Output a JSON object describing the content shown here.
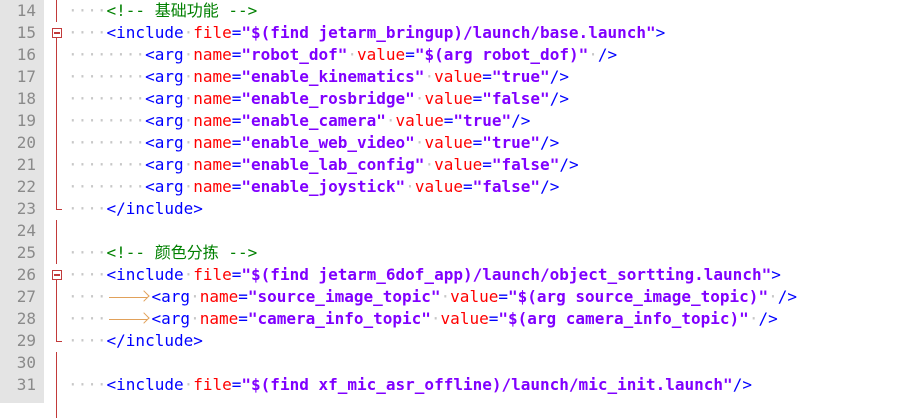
{
  "line_numbers": [
    "14",
    "15",
    "16",
    "17",
    "18",
    "19",
    "20",
    "21",
    "22",
    "23",
    "24",
    "25",
    "26",
    "27",
    "28",
    "29",
    "30",
    "31"
  ],
  "lines": {
    "l14": {
      "c1": "<!-- ",
      "c2": "基础功能",
      "c3": " -->"
    },
    "l15": {
      "tag": "<include",
      "a1": "file",
      "eq": "=",
      "v1": "\"$(find jetarm_bringup)/launch/base.launch\"",
      "close": ">"
    },
    "l16": {
      "tag": "<arg",
      "a1": "name",
      "eq1": "=",
      "v1": "\"robot_dof\"",
      "a2": "value",
      "eq2": "=",
      "v2": "\"$(arg robot_dof)\"",
      "close": "/>"
    },
    "l17": {
      "tag": "<arg",
      "a1": "name",
      "eq1": "=",
      "v1": "\"enable_kinematics\"",
      "a2": "value",
      "eq2": "=",
      "v2": "\"true\"",
      "close": "/>"
    },
    "l18": {
      "tag": "<arg",
      "a1": "name",
      "eq1": "=",
      "v1": "\"enable_rosbridge\"",
      "a2": "value",
      "eq2": "=",
      "v2": "\"false\"",
      "close": "/>"
    },
    "l19": {
      "tag": "<arg",
      "a1": "name",
      "eq1": "=",
      "v1": "\"enable_camera\"",
      "a2": "value",
      "eq2": "=",
      "v2": "\"true\"",
      "close": "/>"
    },
    "l20": {
      "tag": "<arg",
      "a1": "name",
      "eq1": "=",
      "v1": "\"enable_web_video\"",
      "a2": "value",
      "eq2": "=",
      "v2": "\"true\"",
      "close": "/>"
    },
    "l21": {
      "tag": "<arg",
      "a1": "name",
      "eq1": "=",
      "v1": "\"enable_lab_config\"",
      "a2": "value",
      "eq2": "=",
      "v2": "\"false\"",
      "close": "/>"
    },
    "l22": {
      "tag": "<arg",
      "a1": "name",
      "eq1": "=",
      "v1": "\"enable_joystick\"",
      "a2": "value",
      "eq2": "=",
      "v2": "\"false\"",
      "close": "/>"
    },
    "l23": {
      "tag": "</include>"
    },
    "l25": {
      "c1": "<!-- ",
      "c2": "颜色分拣",
      "c3": " -->"
    },
    "l26": {
      "tag": "<include",
      "a1": "file",
      "eq": "=",
      "v1": "\"$(find jetarm_6dof_app)/launch/object_sortting.launch\"",
      "close": ">"
    },
    "l27": {
      "tag": "<arg",
      "a1": "name",
      "eq1": "=",
      "v1": "\"source_image_topic\"",
      "a2": "value",
      "eq2": "=",
      "v2": "\"$(arg source_image_topic)\"",
      "close": "/>"
    },
    "l28": {
      "tag": "<arg",
      "a1": "name",
      "eq1": "=",
      "v1": "\"camera_info_topic\"",
      "a2": "value",
      "eq2": "=",
      "v2": "\"$(arg camera_info_topic)\"",
      "close": "/>"
    },
    "l29": {
      "tag": "</include>"
    },
    "l31": {
      "tag": "<include",
      "a1": "file",
      "eq": "=",
      "v1": "\"$(find xf_mic_asr_offline)/launch/mic_init.launch\"",
      "close": "/>"
    }
  }
}
